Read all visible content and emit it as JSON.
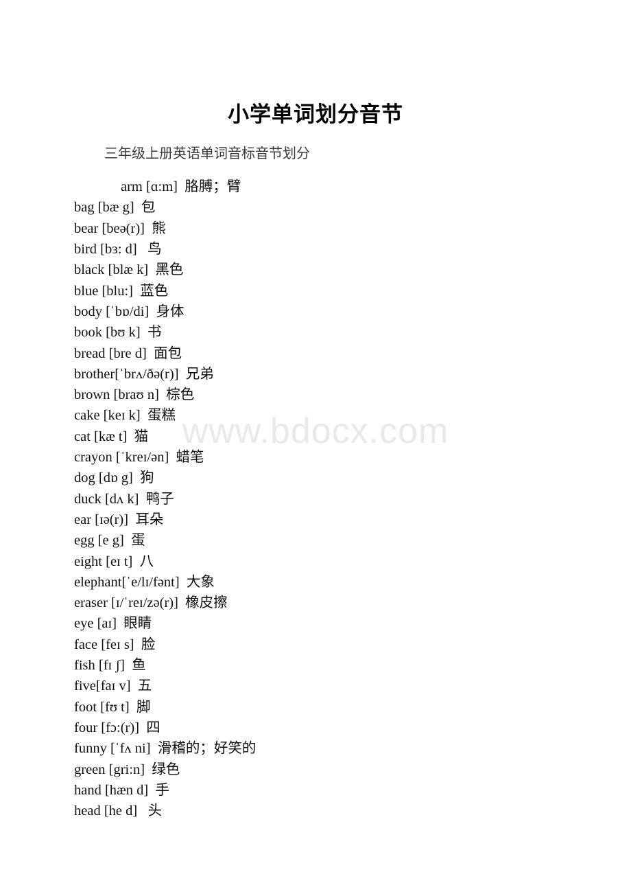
{
  "document": {
    "title": "小学单词划分音节",
    "subtitle": "三年级上册英语单词音标音节划分",
    "watermark": "www.bdocx.com"
  },
  "entries": [
    {
      "word": "arm",
      "ipa": "[ɑ:m]",
      "cn": "胳膊；臂",
      "indent": true,
      "text": "arm [ɑ:m]  胳膊；臂"
    },
    {
      "word": "bag",
      "ipa": "[bæ g]",
      "cn": "包",
      "indent": false,
      "text": "bag [bæ g]  包"
    },
    {
      "word": "bear",
      "ipa": "[beə(r)]",
      "cn": "熊",
      "indent": false,
      "text": "bear [beə(r)]  熊"
    },
    {
      "word": "bird",
      "ipa": "[bɜ: d]",
      "cn": "鸟",
      "indent": false,
      "text": "bird [bɜ: d]   鸟"
    },
    {
      "word": "black",
      "ipa": "[blæ k]",
      "cn": "黑色",
      "indent": false,
      "text": "black [blæ k]  黑色"
    },
    {
      "word": "blue",
      "ipa": "[blu:]",
      "cn": "蓝色",
      "indent": false,
      "text": "blue [blu:]  蓝色"
    },
    {
      "word": "body",
      "ipa": "[ˈbɒ/di]",
      "cn": "身体",
      "indent": false,
      "text": "body [ˈbɒ/di]  身体"
    },
    {
      "word": "book",
      "ipa": "[bʊ k]",
      "cn": "书",
      "indent": false,
      "text": "book [bʊ k]  书"
    },
    {
      "word": "bread",
      "ipa": "[bre d]",
      "cn": "面包",
      "indent": false,
      "text": "bread [bre d]  面包"
    },
    {
      "word": "brother",
      "ipa": "[ˈbrʌ/ðə(r)]",
      "cn": "兄弟",
      "indent": false,
      "text": "brother[ˈbrʌ/ðə(r)]  兄弟"
    },
    {
      "word": "brown",
      "ipa": "[braʊ n]",
      "cn": "棕色",
      "indent": false,
      "text": "brown [braʊ n]  棕色"
    },
    {
      "word": "cake",
      "ipa": "[keɪ k]",
      "cn": "蛋糕",
      "indent": false,
      "text": "cake [keɪ k]  蛋糕"
    },
    {
      "word": "cat",
      "ipa": "[kæ t]",
      "cn": "猫",
      "indent": false,
      "text": "cat [kæ t]  猫"
    },
    {
      "word": "crayon",
      "ipa": "[ˈkreɪ/ən]",
      "cn": "蜡笔",
      "indent": false,
      "text": "crayon [ˈkreɪ/ən]  蜡笔"
    },
    {
      "word": "dog",
      "ipa": "[dɒ g]",
      "cn": "狗",
      "indent": false,
      "text": "dog [dɒ g]  狗"
    },
    {
      "word": "duck",
      "ipa": "[dʌ k]",
      "cn": "鸭子",
      "indent": false,
      "text": "duck [dʌ k]  鸭子"
    },
    {
      "word": "ear",
      "ipa": "[ɪə(r)]",
      "cn": "耳朵",
      "indent": false,
      "text": "ear [ɪə(r)]  耳朵"
    },
    {
      "word": "egg",
      "ipa": "[e g]",
      "cn": "蛋",
      "indent": false,
      "text": "egg [e g]  蛋"
    },
    {
      "word": "eight",
      "ipa": "[eɪ t]",
      "cn": "八",
      "indent": false,
      "text": "eight [eɪ t]  八"
    },
    {
      "word": "elephant",
      "ipa": "[ˈe/lɪ/fənt]",
      "cn": "大象",
      "indent": false,
      "text": "elephant[ˈe/lɪ/fənt]  大象"
    },
    {
      "word": "eraser",
      "ipa": "[ɪ/ˈreɪ/zə(r)]",
      "cn": "橡皮擦",
      "indent": false,
      "text": "eraser [ɪ/ˈreɪ/zə(r)]  橡皮擦"
    },
    {
      "word": "eye",
      "ipa": "[aɪ]",
      "cn": "眼睛",
      "indent": false,
      "text": "eye [aɪ]  眼睛"
    },
    {
      "word": "face",
      "ipa": "[feɪ s]",
      "cn": "脸",
      "indent": false,
      "text": "face [feɪ s]  脸"
    },
    {
      "word": "fish",
      "ipa": "[fɪ ʃ]",
      "cn": "鱼",
      "indent": false,
      "text": "fish [fɪ ʃ]  鱼"
    },
    {
      "word": "five",
      "ipa": "[faɪ v]",
      "cn": "五",
      "indent": false,
      "text": "five[faɪ v]  五"
    },
    {
      "word": "foot",
      "ipa": "[fʊ t]",
      "cn": "脚",
      "indent": false,
      "text": "foot [fʊ t]  脚"
    },
    {
      "word": "four",
      "ipa": "[fɔ:(r)]",
      "cn": "四",
      "indent": false,
      "text": "four [fɔ:(r)]  四"
    },
    {
      "word": "funny",
      "ipa": "[ˈfʌ ni]",
      "cn": "滑稽的；好笑的",
      "indent": false,
      "text": "funny [ˈfʌ ni]  滑稽的；好笑的"
    },
    {
      "word": "green",
      "ipa": "[gri:n]",
      "cn": "绿色",
      "indent": false,
      "text": "green [gri:n]  绿色"
    },
    {
      "word": "hand",
      "ipa": "[hæn d]",
      "cn": "手",
      "indent": false,
      "text": "hand [hæn d]  手"
    },
    {
      "word": "head",
      "ipa": "[he d]",
      "cn": "头",
      "indent": false,
      "text": "head [he d]   头"
    }
  ]
}
